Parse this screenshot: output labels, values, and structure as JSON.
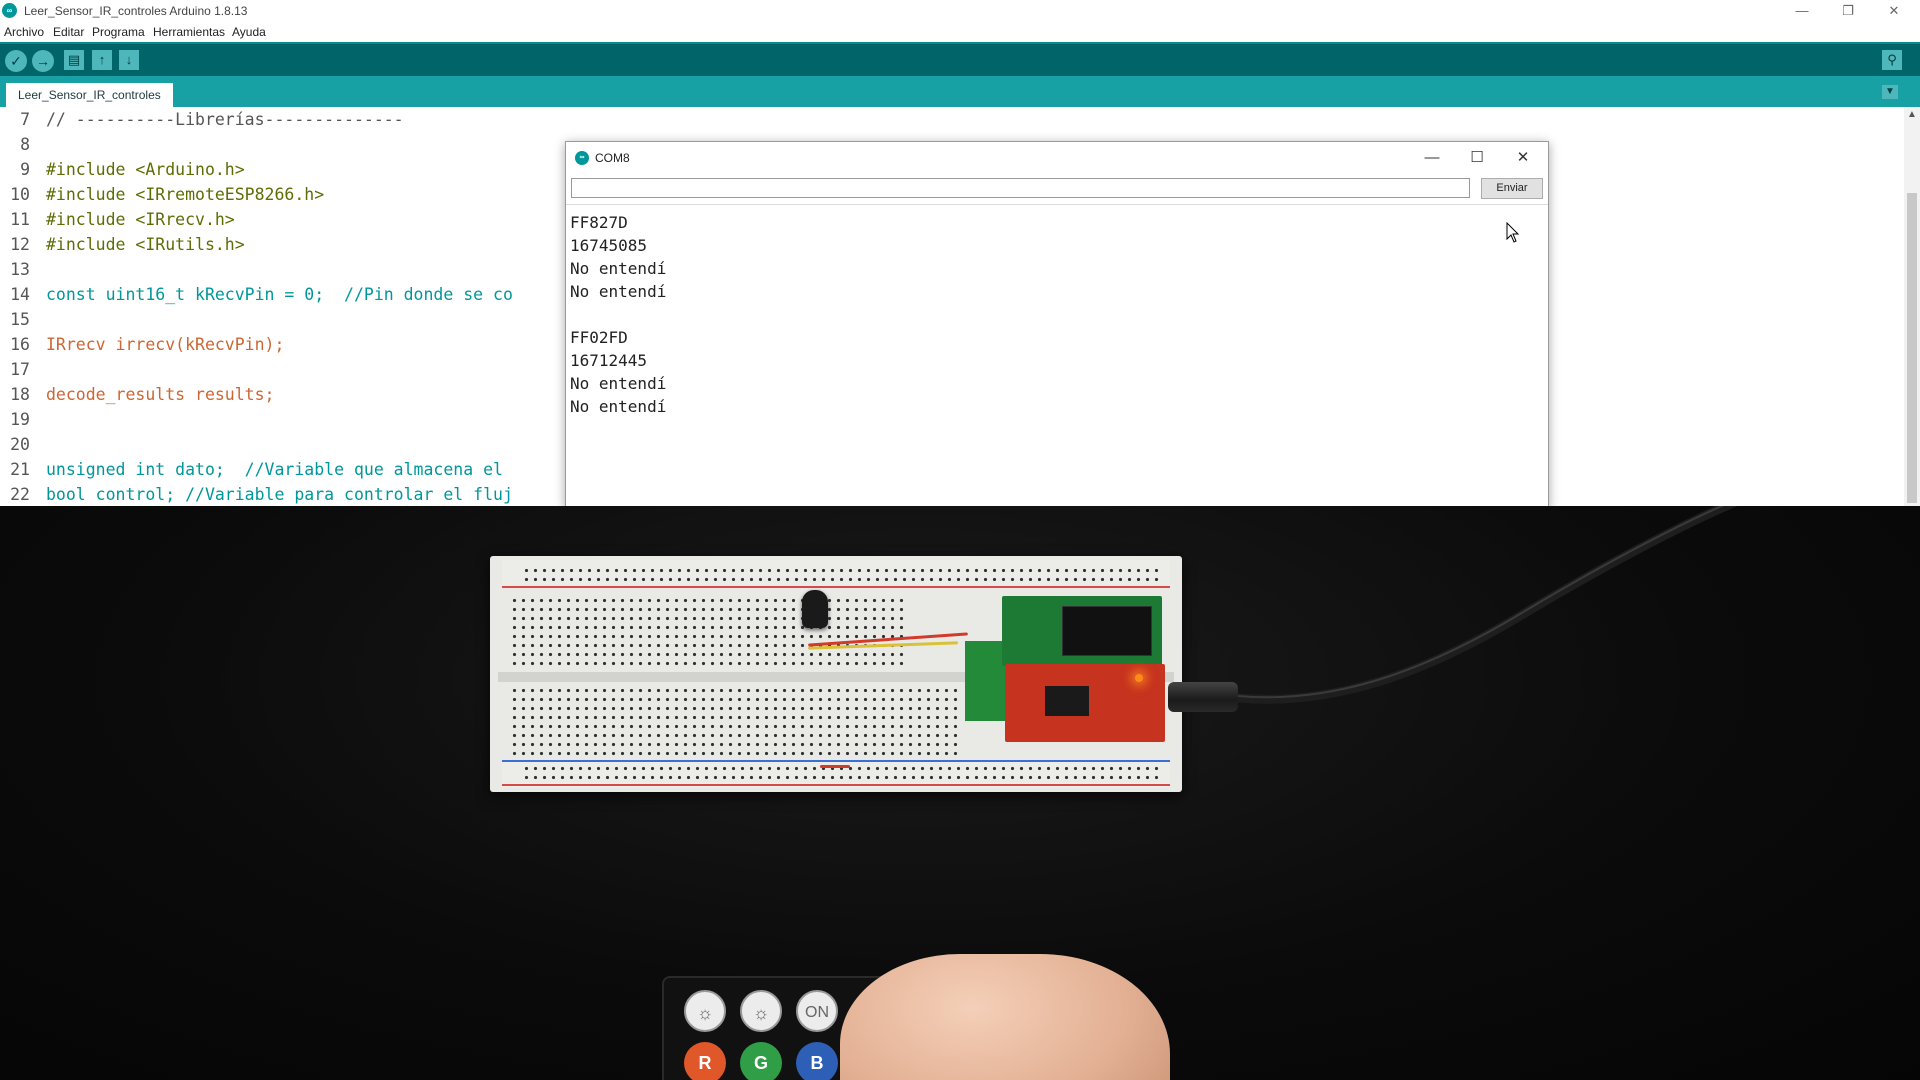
{
  "window": {
    "title": "Leer_Sensor_IR_controles Arduino 1.8.13",
    "icon": "arduino-logo-icon",
    "controls": [
      "minimize-icon",
      "restore-icon",
      "close-icon"
    ]
  },
  "menu": {
    "items": [
      "Archivo",
      "Editar",
      "Programa",
      "Herramientas",
      "Ayuda"
    ]
  },
  "toolbar": {
    "buttons": [
      "verify-icon",
      "upload-icon",
      "new-icon",
      "open-icon",
      "save-icon",
      "serial-monitor-icon"
    ]
  },
  "tabs": {
    "active": "Leer_Sensor_IR_controles"
  },
  "editor": {
    "lines": [
      {
        "n": "7",
        "text": "// ----------Librerías--------------"
      },
      {
        "n": "8",
        "text": ""
      },
      {
        "n": "9",
        "text": "#include <Arduino.h>"
      },
      {
        "n": "10",
        "text": "#include <IRremoteESP8266.h>"
      },
      {
        "n": "11",
        "text": "#include <IRrecv.h>"
      },
      {
        "n": "12",
        "text": "#include <IRutils.h>"
      },
      {
        "n": "13",
        "text": ""
      },
      {
        "n": "14",
        "text": "const uint16_t kRecvPin = 0;  //Pin donde se co"
      },
      {
        "n": "15",
        "text": ""
      },
      {
        "n": "16",
        "text": "IRrecv irrecv(kRecvPin);"
      },
      {
        "n": "17",
        "text": ""
      },
      {
        "n": "18",
        "text": "decode_results results;"
      },
      {
        "n": "19",
        "text": ""
      },
      {
        "n": "20",
        "text": ""
      },
      {
        "n": "21",
        "text": "unsigned int dato;  //Variable que almacena el"
      },
      {
        "n": "22",
        "text": "bool control; //Variable para controlar el fluj"
      }
    ]
  },
  "serial_monitor": {
    "title": "COM8",
    "input_value": "",
    "send_label": "Enviar",
    "output": [
      "FF827D",
      "16745085",
      "No entendí",
      "No entendí",
      "",
      "FF02FD",
      "16712445",
      "No entendí",
      "No entendí"
    ]
  },
  "camera": {
    "remote_buttons": [
      "☼",
      "☼",
      "ON",
      "R",
      "G",
      "B"
    ],
    "colors": {
      "R": "#e0572a",
      "G": "#2f9e47",
      "B": "#2c5fb5"
    }
  },
  "colors": {
    "toolbar": "#006468",
    "tabbar": "#17a1a5",
    "accent": "#00979c"
  }
}
